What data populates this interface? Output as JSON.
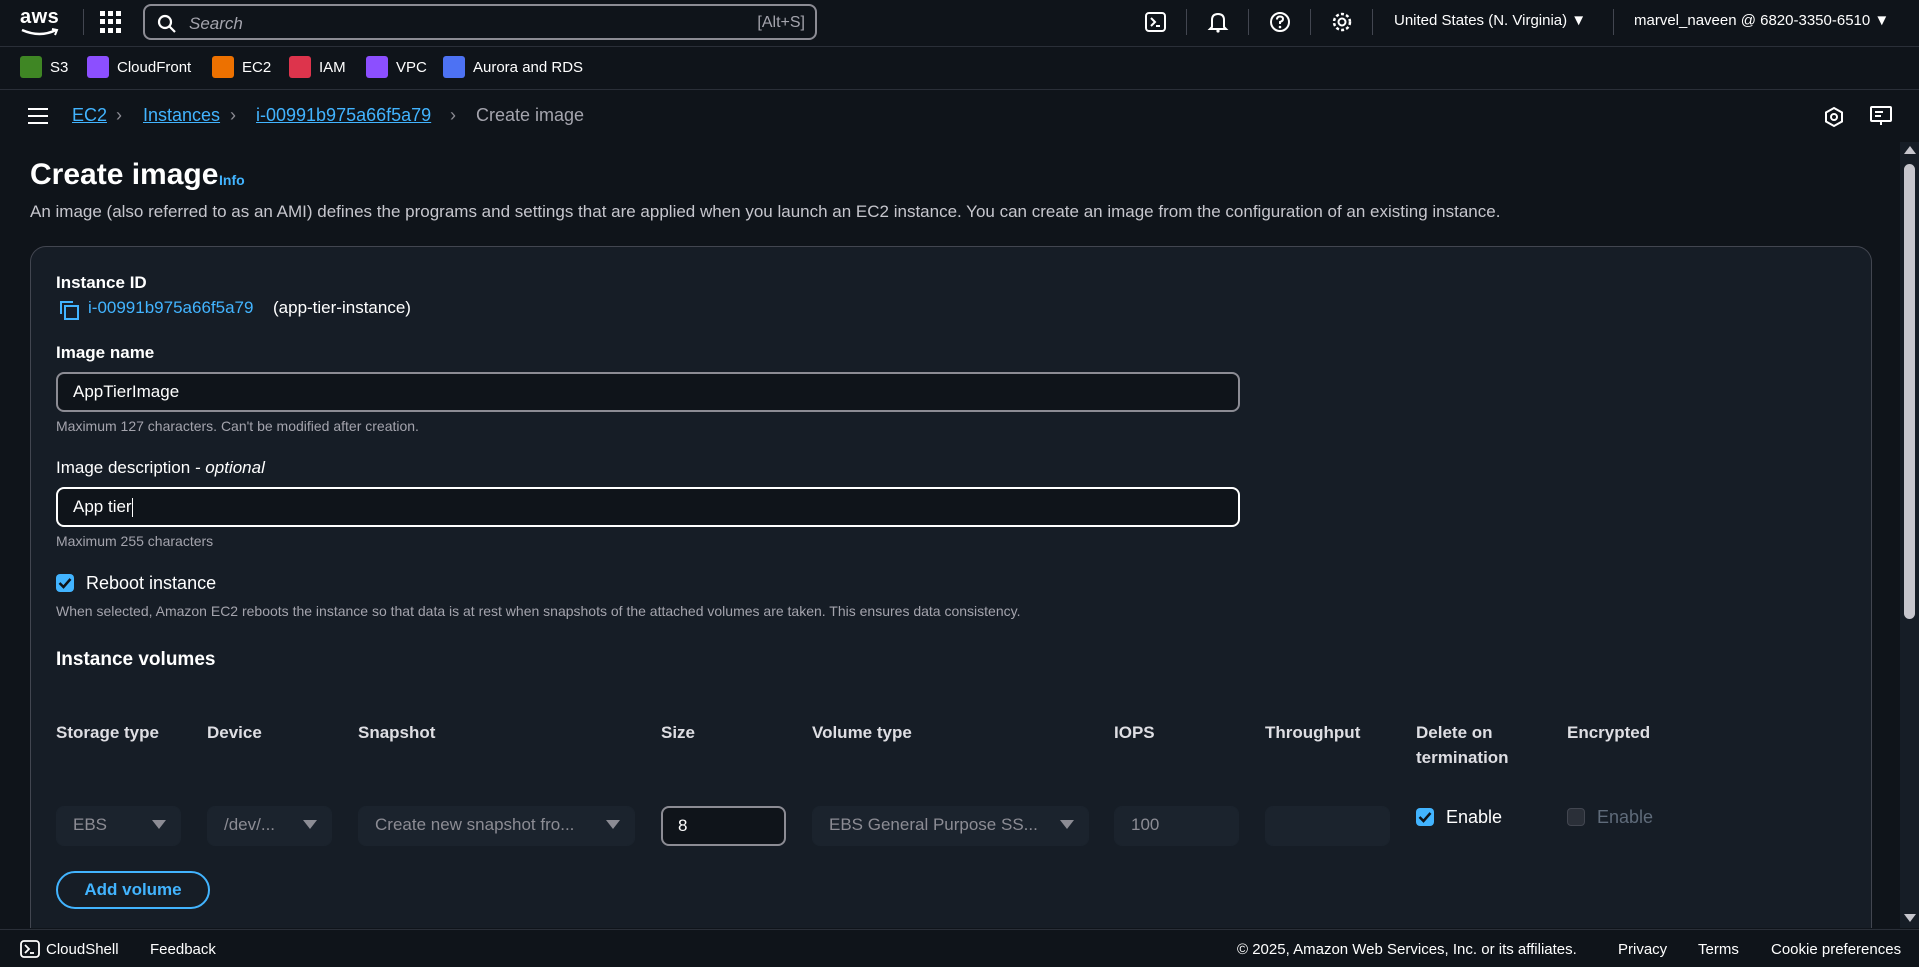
{
  "topnav": {
    "logo_text": "aws",
    "search_placeholder": "Search",
    "search_shortcut": "[Alt+S]",
    "region": "United States (N. Virginia) ▼",
    "account": "marvel_naveen @ 6820-3350-6510 ▼"
  },
  "favorites": [
    {
      "label": "S3",
      "icon": "s3-icon",
      "color": "#3f8624"
    },
    {
      "label": "CloudFront",
      "icon": "cloudfront-icon",
      "color": "#8c4fff"
    },
    {
      "label": "EC2",
      "icon": "ec2-icon",
      "color": "#ed7100"
    },
    {
      "label": "IAM",
      "icon": "iam-icon",
      "color": "#dd344c"
    },
    {
      "label": "VPC",
      "icon": "vpc-icon",
      "color": "#8c4fff"
    },
    {
      "label": "Aurora and RDS",
      "icon": "rds-icon",
      "color": "#4d72f3"
    }
  ],
  "breadcrumb": {
    "items": [
      "EC2",
      "Instances",
      "i-00991b975a66f5a79"
    ],
    "current": "Create image"
  },
  "page": {
    "title": "Create image",
    "info": "Info",
    "description": "An image (also referred to as an AMI) defines the programs and settings that are applied when you launch an EC2 instance. You can create an image from the configuration of an existing instance."
  },
  "form": {
    "instance_id_label": "Instance ID",
    "instance_id": "i-00991b975a66f5a79",
    "instance_name": "(app-tier-instance)",
    "image_name_label": "Image name",
    "image_name_value": "AppTierImage",
    "image_name_hint": "Maximum 127 characters. Can't be modified after creation.",
    "image_desc_label": "Image description",
    "image_desc_optional": "- optional",
    "image_desc_value": "App tier",
    "image_desc_hint": "Maximum 255 characters",
    "reboot_label": "Reboot instance",
    "reboot_checked": true,
    "reboot_hint": "When selected, Amazon EC2 reboots the instance so that data is at rest when snapshots of the attached volumes are taken. This ensures data consistency."
  },
  "volumes": {
    "title": "Instance volumes",
    "headers": {
      "storage_type": "Storage type",
      "device": "Device",
      "snapshot": "Snapshot",
      "size": "Size",
      "volume_type": "Volume type",
      "iops": "IOPS",
      "throughput": "Throughput",
      "delete_on_termination_1": "Delete on",
      "delete_on_termination_2": "termination",
      "encrypted": "Encrypted"
    },
    "row": {
      "storage_type": "EBS",
      "device": "/dev/...",
      "snapshot": "Create new snapshot fro...",
      "size": "8",
      "volume_type": "EBS General Purpose SS...",
      "iops": "100",
      "throughput": "",
      "delete_on_termination": "Enable",
      "encrypted": "Enable"
    },
    "add_volume": "Add volume"
  },
  "footer": {
    "cloudshell": "CloudShell",
    "feedback": "Feedback",
    "copyright": "© 2025, Amazon Web Services, Inc. or its affiliates.",
    "privacy": "Privacy",
    "terms": "Terms",
    "cookie": "Cookie preferences"
  }
}
